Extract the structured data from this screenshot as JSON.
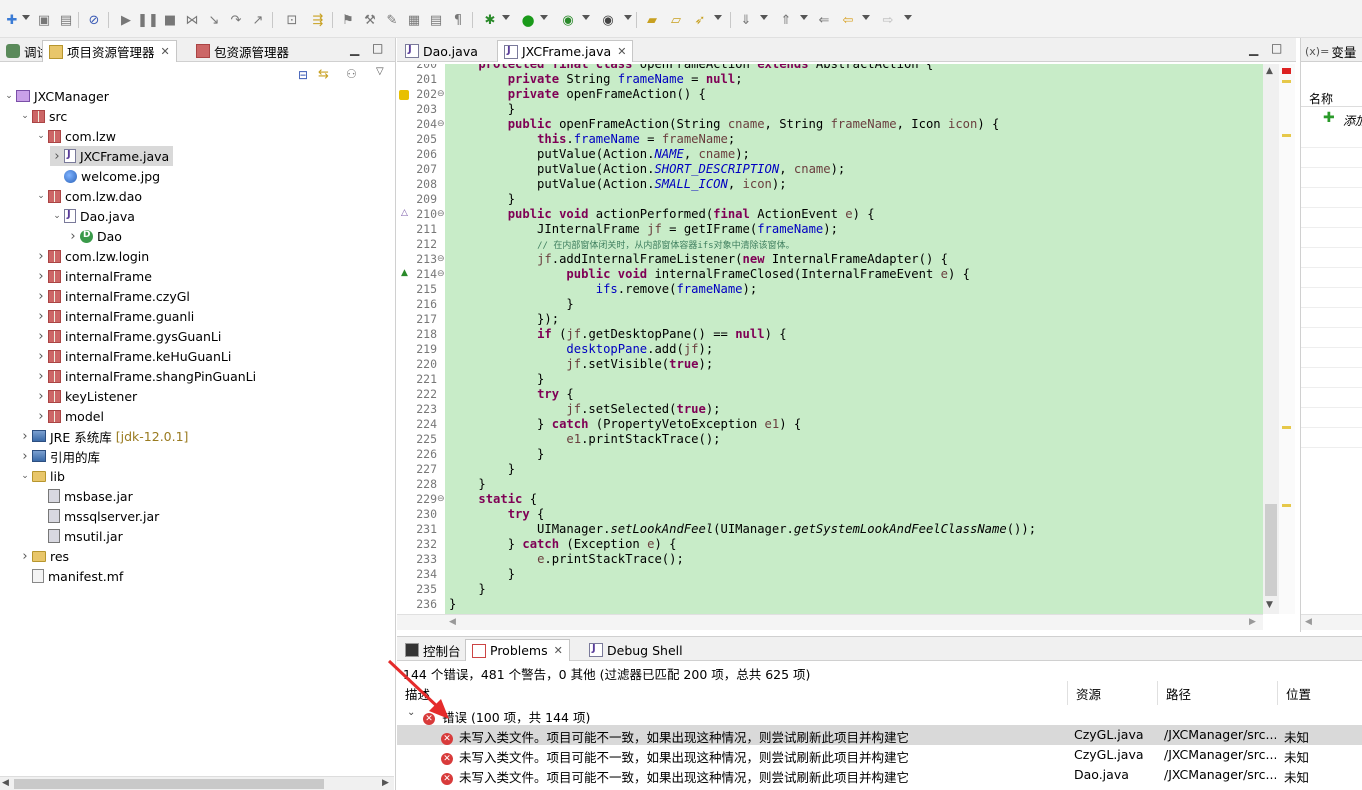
{
  "left_panel": {
    "tabs": [
      {
        "label": "调试",
        "active": false
      },
      {
        "label": "项目资源管理器",
        "active": true
      },
      {
        "label": "包资源管理器",
        "active": false
      }
    ],
    "tree": [
      {
        "label": "JXCManager",
        "icon": "project-icon",
        "depth": 0,
        "expanded": true
      },
      {
        "label": "src",
        "icon": "package-folder-icon",
        "depth": 1,
        "expanded": true
      },
      {
        "label": "com.lzw",
        "icon": "package-icon",
        "depth": 2,
        "expanded": true
      },
      {
        "label": "JXCFrame.java",
        "icon": "java-file-icon",
        "depth": 3,
        "expanded": false,
        "selected": true
      },
      {
        "label": "welcome.jpg",
        "icon": "image-icon",
        "depth": 3
      },
      {
        "label": "com.lzw.dao",
        "icon": "package-icon",
        "depth": 2,
        "expanded": true
      },
      {
        "label": "Dao.java",
        "icon": "java-file-icon",
        "depth": 3,
        "expanded": true
      },
      {
        "label": "Dao",
        "icon": "class-icon",
        "depth": 4,
        "expanded": false
      },
      {
        "label": "com.lzw.login",
        "icon": "package-icon",
        "depth": 2,
        "expanded": false
      },
      {
        "label": "internalFrame",
        "icon": "package-icon",
        "depth": 2,
        "expanded": false
      },
      {
        "label": "internalFrame.czyGl",
        "icon": "package-icon",
        "depth": 2,
        "expanded": false
      },
      {
        "label": "internalFrame.guanli",
        "icon": "package-icon",
        "depth": 2,
        "expanded": false
      },
      {
        "label": "internalFrame.gysGuanLi",
        "icon": "package-icon",
        "depth": 2,
        "expanded": false
      },
      {
        "label": "internalFrame.keHuGuanLi",
        "icon": "package-icon",
        "depth": 2,
        "expanded": false
      },
      {
        "label": "internalFrame.shangPinGuanLi",
        "icon": "package-icon",
        "depth": 2,
        "expanded": false
      },
      {
        "label": "keyListener",
        "icon": "package-icon",
        "depth": 2,
        "expanded": false
      },
      {
        "label": "model",
        "icon": "package-icon",
        "depth": 2,
        "expanded": false
      },
      {
        "label": "JRE 系统库",
        "suffix": "[jdk-12.0.1]",
        "icon": "library-icon",
        "depth": 1,
        "expanded": false
      },
      {
        "label": "引用的库",
        "icon": "library-icon",
        "depth": 1,
        "expanded": false
      },
      {
        "label": "lib",
        "icon": "folder-icon",
        "depth": 1,
        "expanded": true
      },
      {
        "label": "msbase.jar",
        "icon": "jar-icon",
        "depth": 2
      },
      {
        "label": "mssqlserver.jar",
        "icon": "jar-icon",
        "depth": 2
      },
      {
        "label": "msutil.jar",
        "icon": "jar-icon",
        "depth": 2
      },
      {
        "label": "res",
        "icon": "folder-icon",
        "depth": 1,
        "expanded": false
      },
      {
        "label": "manifest.mf",
        "icon": "manifest-file-icon",
        "depth": 1
      }
    ]
  },
  "editor": {
    "tabs": [
      {
        "label": "Dao.java",
        "active": false
      },
      {
        "label": "JXCFrame.java",
        "active": true
      }
    ],
    "lines": [
      {
        "n": "200",
        "html": "    <span class='kw'>protected final class</span> openFrameAction <span class='kw'>extends</span> AbstractAction {"
      },
      {
        "n": "201",
        "html": "        <span class='kw'>private</span> String <span class='fd'>frameName</span> = <span class='kw'>null</span>;"
      },
      {
        "n": "202",
        "html": "        <span class='kw'>private</span> openFrameAction() {"
      },
      {
        "n": "203",
        "html": "        }"
      },
      {
        "n": "204",
        "html": "        <span class='kw'>public</span> openFrameAction(String <span class='lv'>cname</span>, String <span class='lv'>frameName</span>, Icon <span class='lv'>icon</span>) {"
      },
      {
        "n": "205",
        "html": "            <span class='kw'>this</span>.<span class='fd'>frameName</span> = <span class='lv'>frameName</span>;"
      },
      {
        "n": "206",
        "html": "            putValue(Action.<span class='st'>NAME</span>, <span class='lv'>cname</span>);"
      },
      {
        "n": "207",
        "html": "            putValue(Action.<span class='st'>SHORT_DESCRIPTION</span>, <span class='lv'>cname</span>);"
      },
      {
        "n": "208",
        "html": "            putValue(Action.<span class='st'>SMALL_ICON</span>, <span class='lv'>icon</span>);"
      },
      {
        "n": "209",
        "html": "        }"
      },
      {
        "n": "210",
        "html": "        <span class='kw'>public void</span> actionPerformed(<span class='kw'>final</span> ActionEvent <span class='lv'>e</span>) {"
      },
      {
        "n": "211",
        "html": "            JInternalFrame <span class='lv'>jf</span> = getIFrame(<span class='fd'>frameName</span>);"
      },
      {
        "n": "212",
        "html": "            <span class='cm'>// 在内部窗体闭关时，从内部窗体容器ifs对象中清除该窗体。</span>"
      },
      {
        "n": "213",
        "html": "            <span class='lv'>jf</span>.addInternalFrameListener(<span class='kw'>new</span> InternalFrameAdapter() {"
      },
      {
        "n": "214",
        "html": "                <span class='kw'>public void</span> internalFrameClosed(InternalFrameEvent <span class='lv'>e</span>) {"
      },
      {
        "n": "215",
        "html": "                    <span class='fd'>ifs</span>.remove(<span class='fd'>frameName</span>);"
      },
      {
        "n": "216",
        "html": "                }"
      },
      {
        "n": "217",
        "html": "            });"
      },
      {
        "n": "218",
        "html": "            <span class='kw'>if</span> (<span class='lv'>jf</span>.getDesktopPane() == <span class='kw'>null</span>) {"
      },
      {
        "n": "219",
        "html": "                <span class='fd'>desktopPane</span>.add(<span class='lv'>jf</span>);"
      },
      {
        "n": "220",
        "html": "                <span class='lv'>jf</span>.setVisible(<span class='kw'>true</span>);"
      },
      {
        "n": "221",
        "html": "            }"
      },
      {
        "n": "222",
        "html": "            <span class='kw'>try</span> {"
      },
      {
        "n": "223",
        "html": "                <span class='lv'>jf</span>.setSelected(<span class='kw'>true</span>);"
      },
      {
        "n": "224",
        "html": "            } <span class='kw'>catch</span> (PropertyVetoException <span class='lv'>e1</span>) {"
      },
      {
        "n": "225",
        "html": "                <span class='lv'>e1</span>.printStackTrace();"
      },
      {
        "n": "226",
        "html": "            }"
      },
      {
        "n": "227",
        "html": "        }"
      },
      {
        "n": "228",
        "html": "    }"
      },
      {
        "n": "229",
        "html": "    <span class='kw'>static</span> {"
      },
      {
        "n": "230",
        "html": "        <span class='kw'>try</span> {"
      },
      {
        "n": "231",
        "html": "            UIManager.<span class='it'>setLookAndFeel</span>(UIManager.<span class='it'>getSystemLookAndFeelClassName</span>());"
      },
      {
        "n": "232",
        "html": "        } <span class='kw'>catch</span> (Exception <span class='lv'>e</span>) {"
      },
      {
        "n": "233",
        "html": "            <span class='lv'>e</span>.printStackTrace();"
      },
      {
        "n": "234",
        "html": "        }"
      },
      {
        "n": "235",
        "html": "    }"
      },
      {
        "n": "236",
        "html": "}"
      }
    ],
    "folds": [
      "202",
      "204",
      "210",
      "213",
      "214",
      "229"
    ]
  },
  "vars_panel": {
    "tab_label": "变量",
    "tab_prefix": "(x)=",
    "col_name": "名称",
    "add_label": "添加"
  },
  "problems_panel": {
    "tabs": [
      {
        "label": "控制台",
        "active": false
      },
      {
        "label": "Problems",
        "active": true
      },
      {
        "label": "Debug Shell",
        "active": false
      }
    ],
    "summary": "144 个错误，481 个警告，0 其他 (过滤器已匹配 200 项，总共 625 项)",
    "columns": {
      "desc": "描述",
      "resource": "资源",
      "path": "路径",
      "location": "位置"
    },
    "group_label": "错误 (100 项，共 144 项)",
    "rows": [
      {
        "desc": "未写入类文件。项目可能不一致，如果出现这种情况，则尝试刷新此项目并构建它",
        "resource": "CzyGL.java",
        "path": "/JXCManager/src...",
        "location": "未知",
        "selected": true
      },
      {
        "desc": "未写入类文件。项目可能不一致，如果出现这种情况，则尝试刷新此项目并构建它",
        "resource": "CzyGL.java",
        "path": "/JXCManager/src...",
        "location": "未知"
      },
      {
        "desc": "未写入类文件。项目可能不一致，如果出现这种情况，则尝试刷新此项目并构建它",
        "resource": "Dao.java",
        "path": "/JXCManager/src...",
        "location": "未知"
      }
    ]
  }
}
